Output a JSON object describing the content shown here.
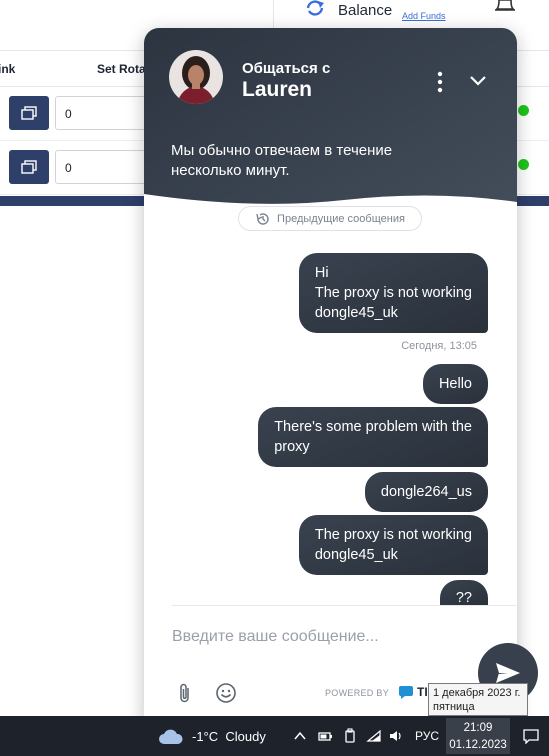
{
  "app": {
    "balance_label": "Balance",
    "add_funds_label": "Add Funds",
    "table": {
      "columns": [
        "ink",
        "Set Rota"
      ],
      "rows": [
        {
          "rotation_value": "0",
          "status_color": "#1ec41e"
        },
        {
          "rotation_value": "0",
          "status_color": "#1ec41e"
        }
      ]
    }
  },
  "chat": {
    "talk_with": "Общаться с",
    "agent_name": "Lauren",
    "reply_note": "Мы обычно отвечаем в течение несколько минут.",
    "previous_messages": "Предыдущие сообщения",
    "messages": [
      {
        "text": "Hi\nThe proxy is not working\ndongle45_uk"
      },
      {
        "text": "Hello"
      },
      {
        "text": "There's some problem with the\nproxy"
      },
      {
        "text": "dongle264_us"
      },
      {
        "text": "The proxy is not working\ndongle45_uk"
      },
      {
        "text": "??"
      }
    ],
    "timestamp": "Сегодня, 13:05",
    "input_placeholder": "Введите ваше сообщение...",
    "powered_by": "POWERED BY",
    "brand": "TI",
    "accent_color": "#2c3440"
  },
  "tooltip": {
    "date_line": "1 декабря 2023 г.",
    "weekday": "пятница"
  },
  "taskbar": {
    "weather": "-1°C  Cloudy",
    "language": "РУС",
    "time": "21:09",
    "date": "01.12.2023"
  }
}
